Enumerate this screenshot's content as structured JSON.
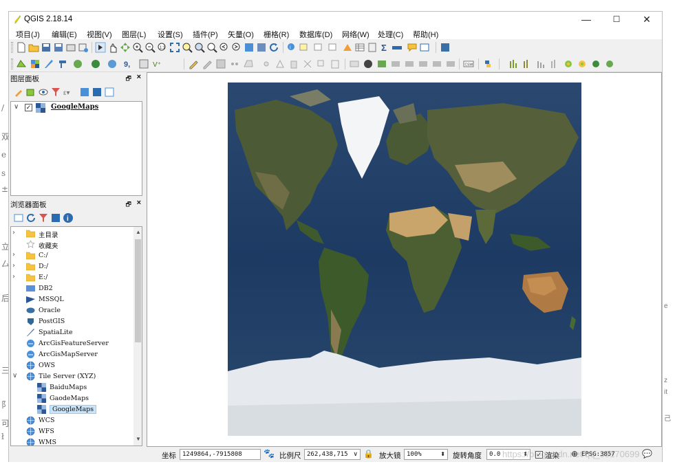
{
  "app": {
    "title": "QGIS 2.18.14"
  },
  "window_controls": {
    "minimize": "—",
    "maximize": "☐",
    "close": "✕"
  },
  "menu": [
    "项目(J)",
    "编辑(E)",
    "视图(V)",
    "图层(L)",
    "设置(S)",
    "插件(P)",
    "矢量(O)",
    "栅格(R)",
    "数据库(D)",
    "网络(W)",
    "处理(C)",
    "帮助(H)"
  ],
  "layers_panel": {
    "title": "图层面板",
    "layer": {
      "name": "GoogleMaps",
      "checked": true
    }
  },
  "browser_panel": {
    "title": "浏览器面板",
    "items": [
      {
        "label": "主目录",
        "icon": "folder-icon",
        "arrow": ">"
      },
      {
        "label": "收藏夹",
        "icon": "star-icon",
        "arrow": ""
      },
      {
        "label": "C:/",
        "icon": "folder-icon",
        "arrow": ">"
      },
      {
        "label": "D:/",
        "icon": "folder-icon",
        "arrow": ">"
      },
      {
        "label": "E:/",
        "icon": "folder-icon",
        "arrow": ">"
      },
      {
        "label": "DB2",
        "icon": "db2-icon",
        "arrow": ""
      },
      {
        "label": "MSSQL",
        "icon": "mssql-icon",
        "arrow": ""
      },
      {
        "label": "Oracle",
        "icon": "oracle-icon",
        "arrow": ""
      },
      {
        "label": "PostGIS",
        "icon": "postgis-icon",
        "arrow": ""
      },
      {
        "label": "SpatiaLite",
        "icon": "spatialite-icon",
        "arrow": ""
      },
      {
        "label": "ArcGisFeatureServer",
        "icon": "arcgis-icon",
        "arrow": ""
      },
      {
        "label": "ArcGisMapServer",
        "icon": "arcgis-icon",
        "arrow": ""
      },
      {
        "label": "OWS",
        "icon": "globe-icon",
        "arrow": ""
      },
      {
        "label": "Tile Server (XYZ)",
        "icon": "globe-icon",
        "arrow": "v"
      },
      {
        "label": "BaiduMaps",
        "icon": "tiles-icon",
        "arrow": ""
      },
      {
        "label": "GaodeMaps",
        "icon": "tiles-icon",
        "arrow": ""
      },
      {
        "label": "GoogleMaps",
        "icon": "tiles-icon",
        "arrow": "",
        "selected": true
      },
      {
        "label": "WCS",
        "icon": "globe-icon",
        "arrow": ""
      },
      {
        "label": "WFS",
        "icon": "globe-icon",
        "arrow": ""
      },
      {
        "label": "WMS",
        "icon": "globe-icon",
        "arrow": ""
      }
    ]
  },
  "status": {
    "coord_label": "坐标",
    "coord_value": "1249864,-7915808",
    "scale_label": "比例尺",
    "scale_value": "262,438,715",
    "magnifier_label": "放大镜",
    "magnifier_value": "100%",
    "rotation_label": "旋转角度",
    "rotation_value": "0.0",
    "render_label": "渲染",
    "render_checked": true,
    "crs": "EPSG:3857"
  },
  "watermark": "https://blog.csdn.net/qq_38170699",
  "colors": {
    "ocean": "#1e3a63",
    "ice": "#e8ecf0",
    "selection": "#cce4f7"
  }
}
